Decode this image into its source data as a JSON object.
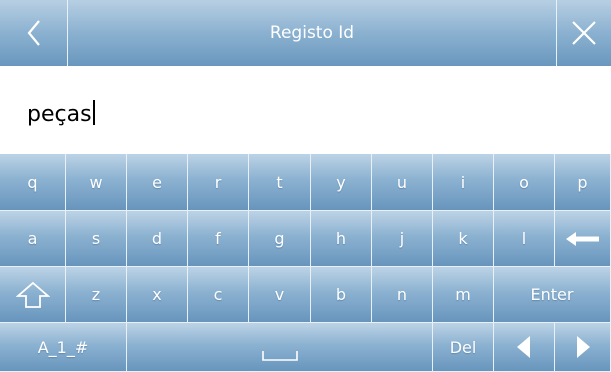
{
  "header": {
    "title": "Registo Id",
    "back_icon": "chevron-left-icon",
    "close_icon": "close-icon"
  },
  "input": {
    "value": "peças"
  },
  "keyboard": {
    "row1": [
      "q",
      "w",
      "e",
      "r",
      "t",
      "y",
      "u",
      "i",
      "o",
      "p"
    ],
    "row2": [
      "a",
      "s",
      "d",
      "f",
      "g",
      "h",
      "j",
      "k",
      "l"
    ],
    "row3": [
      "z",
      "x",
      "c",
      "v",
      "b",
      "n",
      "m"
    ],
    "enter_label": "Enter",
    "mode_label": "A_1_#",
    "del_label": "Del",
    "backspace_icon": "backspace-arrow-icon",
    "shift_icon": "shift-arrow-icon",
    "space_icon": "space-bar-icon",
    "left_icon": "cursor-left-icon",
    "right_icon": "cursor-right-icon"
  },
  "colors": {
    "key_top": "#bcd3e6",
    "key_bottom": "#6895bd",
    "divider": "#e9f1f8",
    "text": "#ffffff"
  }
}
